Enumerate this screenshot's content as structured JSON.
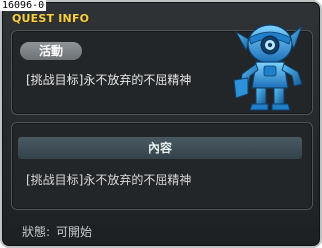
{
  "quest_id": "16096-0",
  "title": "QUEST INFO",
  "category_tag": "活動",
  "quest_name": "[挑战目标]永不放弃的不屈精神",
  "content_header": "內容",
  "content_text": "[挑战目标]永不放弃的不屈精神",
  "status": {
    "label": "狀態:",
    "value": "可開始"
  },
  "icons": {
    "character": "blue-robot-character-icon"
  },
  "colors": {
    "title": "#f2d04a",
    "window_bg": "#2a2d30",
    "character_blue": "#3aa8e8"
  }
}
